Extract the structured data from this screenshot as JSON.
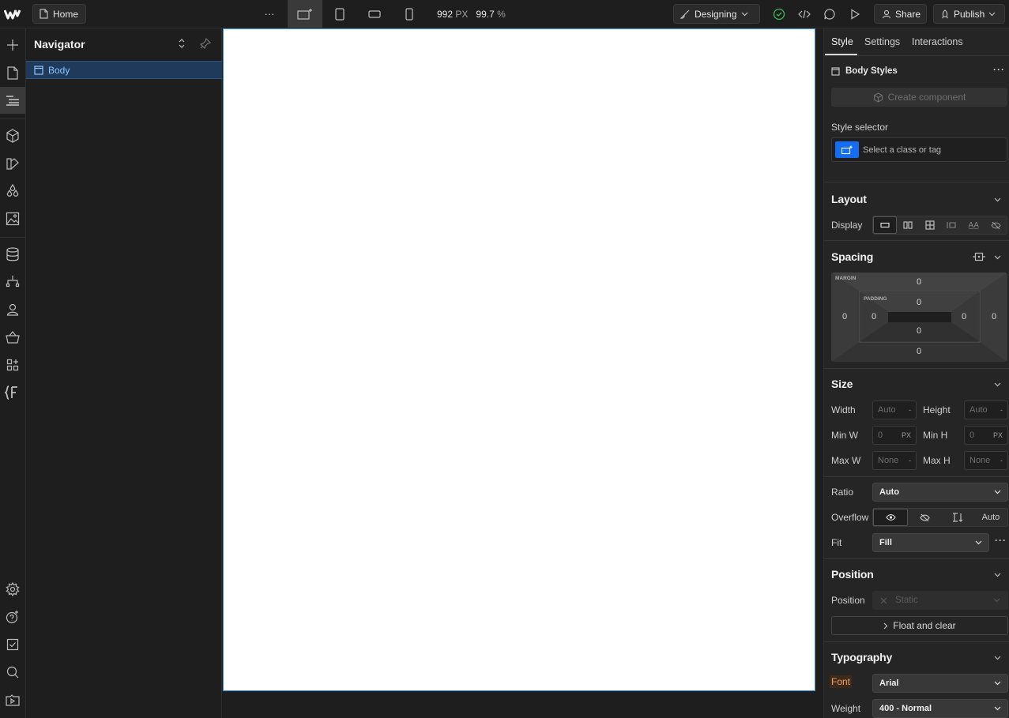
{
  "topbar": {
    "home_label": "Home",
    "more_label": "···",
    "width_value": "992",
    "width_unit": "PX",
    "zoom_value": "99.7",
    "zoom_unit": "%",
    "mode_label": "Designing",
    "share_label": "Share",
    "publish_label": "Publish"
  },
  "navigator": {
    "title": "Navigator",
    "tree": [
      {
        "label": "Body",
        "selected": true
      }
    ]
  },
  "panel": {
    "tabs": [
      {
        "label": "Style",
        "active": true
      },
      {
        "label": "Settings",
        "active": false
      },
      {
        "label": "Interactions",
        "active": false
      }
    ],
    "element_title": "Body Styles",
    "create_component_label": "Create component",
    "style_selector_label": "Style selector",
    "style_selector_placeholder": "Select a class or tag",
    "layout": {
      "title": "Layout",
      "display_label": "Display"
    },
    "spacing": {
      "title": "Spacing",
      "margin_label": "MARGIN",
      "padding_label": "PADDING",
      "margin": {
        "top": "0",
        "right": "0",
        "bottom": "0",
        "left": "0"
      },
      "padding": {
        "top": "0",
        "right": "0",
        "bottom": "0",
        "left": "0"
      }
    },
    "size": {
      "title": "Size",
      "width_label": "Width",
      "width_value": "Auto",
      "width_unit": "-",
      "height_label": "Height",
      "height_value": "Auto",
      "height_unit": "-",
      "minw_label": "Min W",
      "minw_value": "0",
      "minw_unit": "PX",
      "minh_label": "Min H",
      "minh_value": "0",
      "minh_unit": "PX",
      "maxw_label": "Max W",
      "maxw_value": "None",
      "maxw_unit": "-",
      "maxh_label": "Max H",
      "maxh_value": "None",
      "maxh_unit": "-",
      "ratio_label": "Ratio",
      "ratio_value": "Auto",
      "overflow_label": "Overflow",
      "overflow_auto": "Auto",
      "fit_label": "Fit",
      "fit_value": "Fill"
    },
    "position": {
      "title": "Position",
      "position_label": "Position",
      "position_value": "Static",
      "float_label": "Float and clear"
    },
    "typography": {
      "title": "Typography",
      "font_label": "Font",
      "font_value": "Arial",
      "weight_label": "Weight",
      "weight_value": "400 - Normal"
    }
  },
  "colors": {
    "accent_blue": "#3c8ddc",
    "selector_blue": "#146ef5",
    "status_green": "#3fb950",
    "font_label_highlight": "#e8a26b"
  }
}
